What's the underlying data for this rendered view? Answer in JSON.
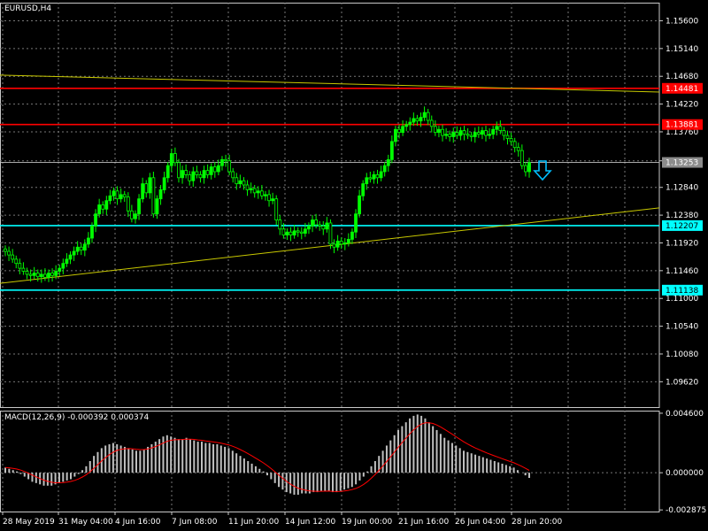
{
  "chart_data": [
    {
      "type": "candlestick",
      "symbol_label": "EURUSD,H4",
      "ylim": [
        1.092,
        1.159
      ],
      "price_ticks": [
        "1.15600",
        "1.15140",
        "1.14680",
        "1.14220",
        "1.13760",
        "1.13280",
        "1.12840",
        "1.12380",
        "1.11920",
        "1.11460",
        "1.11000",
        "1.10540",
        "1.10080",
        "1.09620"
      ],
      "grid": true,
      "x_tick_labels": [
        "28 May 2019",
        "31 May 04:00",
        "4 Jun 16:00",
        "7 Jun 08:00",
        "11 Jun 20:00",
        "14 Jun 12:00",
        "19 Jun 00:00",
        "21 Jun 16:00",
        "26 Jun 04:00",
        "28 Jun 20:00"
      ],
      "current_price": "1.13253",
      "horizontal_levels": [
        {
          "label": "1.14481",
          "value": 1.14481,
          "color": "#ff0000"
        },
        {
          "label": "1.13881",
          "value": 1.13881,
          "color": "#ff0000"
        },
        {
          "label": "1.12207",
          "value": 1.12207,
          "color": "#00ffff"
        },
        {
          "label": "1.11138",
          "value": 1.11138,
          "color": "#00ffff"
        }
      ],
      "trend_lines": [
        {
          "color": "#c8c800",
          "from": [
            0,
            1.147
          ],
          "to": [
            1.0,
            1.1442
          ]
        },
        {
          "color": "#c8c800",
          "from": [
            0,
            1.1125
          ],
          "to": [
            1.0,
            1.125
          ]
        }
      ],
      "signal": "sell-arrow-icon",
      "close_series": [
        1.1178,
        1.1172,
        1.1165,
        1.1158,
        1.115,
        1.1145,
        1.114,
        1.1138,
        1.1142,
        1.1136,
        1.114,
        1.1135,
        1.1142,
        1.1138,
        1.1145,
        1.115,
        1.1158,
        1.1165,
        1.1172,
        1.1178,
        1.1185,
        1.118,
        1.119,
        1.12,
        1.122,
        1.124,
        1.1255,
        1.1248,
        1.1262,
        1.127,
        1.1278,
        1.1265,
        1.1272,
        1.1268,
        1.1245,
        1.1232,
        1.124,
        1.1265,
        1.129,
        1.1275,
        1.13,
        1.124,
        1.1265,
        1.128,
        1.13,
        1.132,
        1.134,
        1.1325,
        1.13,
        1.1312,
        1.1305,
        1.1295,
        1.131,
        1.1305,
        1.13,
        1.1312,
        1.1305,
        1.1318,
        1.131,
        1.132,
        1.133,
        1.1328,
        1.131,
        1.13,
        1.129,
        1.1295,
        1.1288,
        1.128,
        1.1282,
        1.1275,
        1.1278,
        1.127,
        1.1272,
        1.1262,
        1.1265,
        1.123,
        1.1215,
        1.1205,
        1.121,
        1.1205,
        1.1212,
        1.121,
        1.1208,
        1.1215,
        1.122,
        1.123,
        1.1222,
        1.122,
        1.1215,
        1.1225,
        1.119,
        1.1185,
        1.1195,
        1.119,
        1.1192,
        1.1198,
        1.121,
        1.124,
        1.127,
        1.129,
        1.13,
        1.1298,
        1.1305,
        1.13,
        1.131,
        1.132,
        1.133,
        1.136,
        1.138,
        1.1375,
        1.1385,
        1.1388,
        1.1392,
        1.1398,
        1.1394,
        1.14,
        1.1408,
        1.1395,
        1.1385,
        1.1375,
        1.138,
        1.137,
        1.1372,
        1.1368,
        1.1375,
        1.137,
        1.1378,
        1.1372,
        1.137,
        1.1368,
        1.1375,
        1.1372,
        1.1378,
        1.137,
        1.1372,
        1.138,
        1.1385,
        1.1378,
        1.137,
        1.1365,
        1.136,
        1.135,
        1.1345,
        1.132,
        1.131,
        1.1325
      ]
    },
    {
      "type": "bar",
      "indicator_label": "MACD(12,26,9) -0.000392 0.000374",
      "ylim": [
        -0.003,
        0.0048
      ],
      "y_ticks": [
        "0.004600",
        "0.000000",
        "-0.002875"
      ],
      "y_tick_values": [
        0.0046,
        0.0,
        -0.002875
      ],
      "histogram": [
        0.0004,
        0.0003,
        0.0002,
        0.0001,
        -0.0001,
        -0.0003,
        -0.0005,
        -0.0007,
        -0.0008,
        -0.0009,
        -0.001,
        -0.001,
        -0.001,
        -0.0009,
        -0.0008,
        -0.0007,
        -0.0006,
        -0.0005,
        -0.0003,
        -0.0001,
        0.0002,
        0.0005,
        0.0009,
        0.0013,
        0.0016,
        0.0019,
        0.0021,
        0.0022,
        0.0023,
        0.0022,
        0.0021,
        0.002,
        0.0019,
        0.0018,
        0.0017,
        0.0017,
        0.0018,
        0.002,
        0.0022,
        0.0024,
        0.0026,
        0.0028,
        0.0029,
        0.0028,
        0.0027,
        0.0026,
        0.0026,
        0.0027,
        0.0026,
        0.0025,
        0.0024,
        0.0024,
        0.0023,
        0.0023,
        0.0022,
        0.0022,
        0.0021,
        0.002,
        0.0019,
        0.0017,
        0.0015,
        0.0013,
        0.0011,
        0.0009,
        0.0007,
        0.0005,
        0.0003,
        0.0001,
        -0.0002,
        -0.0005,
        -0.0008,
        -0.0011,
        -0.0013,
        -0.0015,
        -0.0016,
        -0.0017,
        -0.0017,
        -0.0016,
        -0.0016,
        -0.0016,
        -0.0015,
        -0.0015,
        -0.0014,
        -0.0014,
        -0.0014,
        -0.0015,
        -0.0015,
        -0.0014,
        -0.0013,
        -0.0012,
        -0.0011,
        -0.0009,
        -0.0006,
        -0.0003,
        0.0001,
        0.0005,
        0.0009,
        0.0013,
        0.0017,
        0.0021,
        0.0025,
        0.0029,
        0.0033,
        0.0036,
        0.0039,
        0.0042,
        0.0044,
        0.0045,
        0.0044,
        0.0042,
        0.0039,
        0.0036,
        0.0033,
        0.003,
        0.0027,
        0.0025,
        0.0023,
        0.0021,
        0.0019,
        0.0017,
        0.0016,
        0.0015,
        0.0014,
        0.0013,
        0.0012,
        0.0011,
        0.001,
        0.0009,
        0.0008,
        0.0007,
        0.0006,
        0.0005,
        0.0004,
        0.0002,
        0.0,
        -0.0002,
        -0.0004
      ],
      "signal_line_color": "#ff0000",
      "histogram_color": "#c0c0c0"
    }
  ],
  "colors": {
    "background": "#000000",
    "grid": "#787878",
    "bull_candle": "#00ff00",
    "bear_candle": "#000000",
    "axis_text": "#ffffff",
    "bid_line": "#c0c0c0",
    "arrow": "#00bfff"
  }
}
